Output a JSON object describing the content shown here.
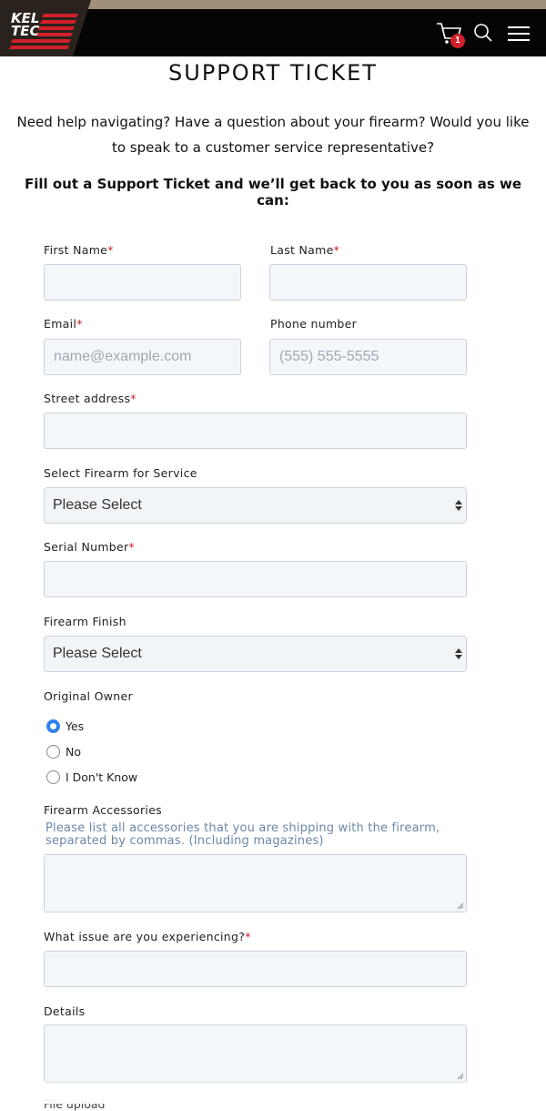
{
  "header": {
    "logo_text_line1": "KEL",
    "logo_text_line2": "TEC",
    "cart_count": "1",
    "icons": [
      "cart-icon",
      "search-icon",
      "menu-icon"
    ]
  },
  "page": {
    "title": "SUPPORT TICKET",
    "intro": "Need help navigating? Have a question about your firearm? Would you like to speak to a customer service representative?",
    "intro_bold": "Fill out a Support Ticket and we’ll get back to you as soon as we can:"
  },
  "form": {
    "first_name_label": "First Name",
    "last_name_label": "Last Name",
    "email_label": "Email",
    "email_placeholder": "name@example.com",
    "phone_label": "Phone number",
    "phone_placeholder": "(555) 555-5555",
    "street_label": "Street address",
    "firearm_label": "Select Firearm for Service",
    "firearm_value": "Please Select",
    "serial_label": "Serial Number",
    "finish_label": "Firearm Finish",
    "finish_value": "Please Select",
    "owner_label": "Original Owner",
    "owner_options": [
      {
        "label": "Yes",
        "checked": true
      },
      {
        "label": "No",
        "checked": false
      },
      {
        "label": "I Don't Know",
        "checked": false
      }
    ],
    "accessories_label": "Firearm Accessories",
    "accessories_help": "Please list all accessories that you are shipping with the firearm, separated by commas. (Including magazines)",
    "issue_label": "What issue are you experiencing?",
    "details_label": "Details",
    "next_label_partial": "File upload",
    "required_mark": "*"
  },
  "colors": {
    "accent_red": "#d0202a",
    "radio_blue": "#2f80ed",
    "help_text": "#6b87a8",
    "field_bg": "#f4f7fa"
  }
}
